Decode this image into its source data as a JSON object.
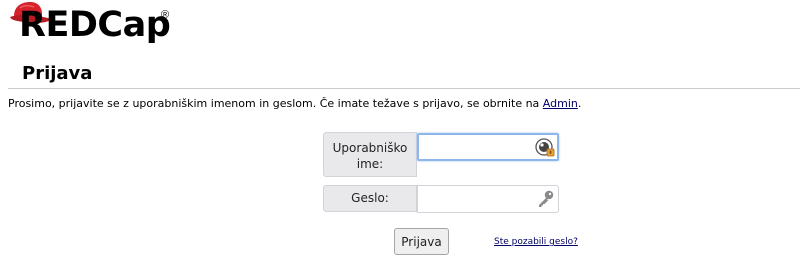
{
  "logo": {
    "text": "REDCap",
    "registered_mark": "®",
    "hat_color": "#d6232b"
  },
  "page": {
    "title": "Prijava",
    "intro_text": "Prosimo, prijavite se z uporabniškim imenom in geslom. Če imate težave s prijavo, se obrnite na ",
    "admin_link": "Admin",
    "intro_end": "."
  },
  "form": {
    "username_label": "Uporabniško ime:",
    "username_value": "",
    "username_icon": "password-manager-key-icon",
    "password_label": "Geslo:",
    "password_value": "",
    "password_icon": "key-icon",
    "login_button": "Prijava",
    "forgot_link": "Ste pozabili geslo?"
  }
}
